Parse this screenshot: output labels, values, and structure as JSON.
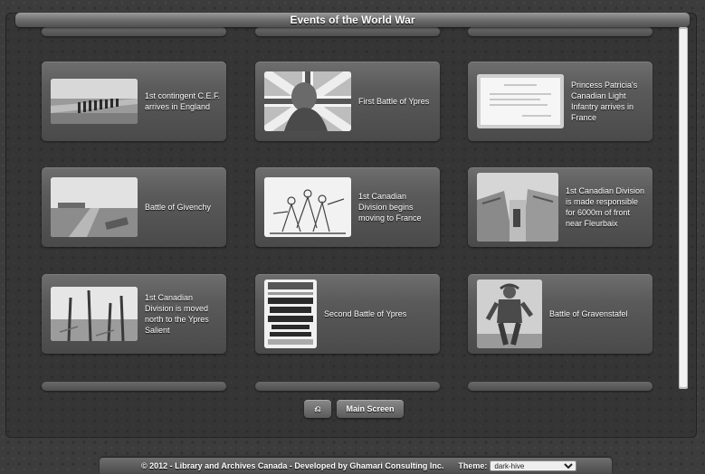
{
  "header": {
    "title": "Events of the World War"
  },
  "events": [
    {
      "label": "1st contingent C.E.F. arrives in England",
      "image": "soldiers-marching-photo"
    },
    {
      "label": "First Battle of Ypres",
      "image": "soldier-flag-poster"
    },
    {
      "label": "Princess Patricia's Canadian Light Infantry arrives in France",
      "image": "document-scan"
    },
    {
      "label": "Battle of Givenchy",
      "image": "trench-field-photo"
    },
    {
      "label": "1st Canadian Division begins moving to France",
      "image": "battle-sketch"
    },
    {
      "label": "1st Canadian Division is made responsible for 6000m of front near Fleurbaix",
      "image": "trench-photo"
    },
    {
      "label": "1st Canadian Division is moved north to the Ypres Salient",
      "image": "battlefield-trees-photo"
    },
    {
      "label": "Second Battle of Ypres",
      "image": "newspaper-front-page"
    },
    {
      "label": "Battle of Gravenstafel",
      "image": "soldier-statue-photo"
    }
  ],
  "controls": {
    "back_icon_label": "⎌",
    "main_screen_label": "Main Screen"
  },
  "footer": {
    "copyright": "© 2012 - Library and Archives Canada - Developed by Ghamari Consulting Inc.",
    "theme_label": "Theme:",
    "theme_value": "dark-hive"
  }
}
